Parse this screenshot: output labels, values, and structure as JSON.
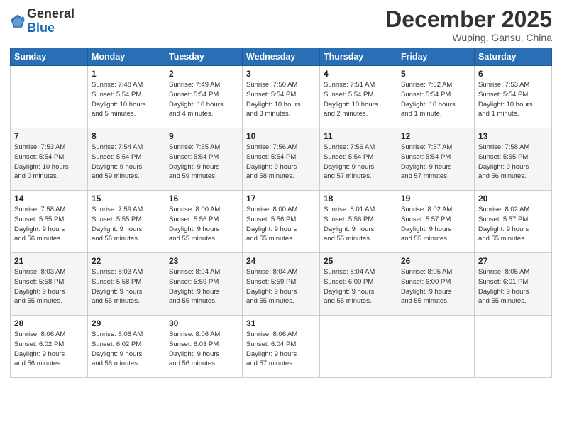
{
  "logo": {
    "general": "General",
    "blue": "Blue"
  },
  "header": {
    "month": "December 2025",
    "location": "Wuping, Gansu, China"
  },
  "days_of_week": [
    "Sunday",
    "Monday",
    "Tuesday",
    "Wednesday",
    "Thursday",
    "Friday",
    "Saturday"
  ],
  "weeks": [
    [
      {
        "day": "",
        "info": ""
      },
      {
        "day": "1",
        "info": "Sunrise: 7:48 AM\nSunset: 5:54 PM\nDaylight: 10 hours\nand 5 minutes."
      },
      {
        "day": "2",
        "info": "Sunrise: 7:49 AM\nSunset: 5:54 PM\nDaylight: 10 hours\nand 4 minutes."
      },
      {
        "day": "3",
        "info": "Sunrise: 7:50 AM\nSunset: 5:54 PM\nDaylight: 10 hours\nand 3 minutes."
      },
      {
        "day": "4",
        "info": "Sunrise: 7:51 AM\nSunset: 5:54 PM\nDaylight: 10 hours\nand 2 minutes."
      },
      {
        "day": "5",
        "info": "Sunrise: 7:52 AM\nSunset: 5:54 PM\nDaylight: 10 hours\nand 1 minute."
      },
      {
        "day": "6",
        "info": "Sunrise: 7:53 AM\nSunset: 5:54 PM\nDaylight: 10 hours\nand 1 minute."
      }
    ],
    [
      {
        "day": "7",
        "info": "Sunrise: 7:53 AM\nSunset: 5:54 PM\nDaylight: 10 hours\nand 0 minutes."
      },
      {
        "day": "8",
        "info": "Sunrise: 7:54 AM\nSunset: 5:54 PM\nDaylight: 9 hours\nand 59 minutes."
      },
      {
        "day": "9",
        "info": "Sunrise: 7:55 AM\nSunset: 5:54 PM\nDaylight: 9 hours\nand 59 minutes."
      },
      {
        "day": "10",
        "info": "Sunrise: 7:56 AM\nSunset: 5:54 PM\nDaylight: 9 hours\nand 58 minutes."
      },
      {
        "day": "11",
        "info": "Sunrise: 7:56 AM\nSunset: 5:54 PM\nDaylight: 9 hours\nand 57 minutes."
      },
      {
        "day": "12",
        "info": "Sunrise: 7:57 AM\nSunset: 5:54 PM\nDaylight: 9 hours\nand 57 minutes."
      },
      {
        "day": "13",
        "info": "Sunrise: 7:58 AM\nSunset: 5:55 PM\nDaylight: 9 hours\nand 56 minutes."
      }
    ],
    [
      {
        "day": "14",
        "info": "Sunrise: 7:58 AM\nSunset: 5:55 PM\nDaylight: 9 hours\nand 56 minutes."
      },
      {
        "day": "15",
        "info": "Sunrise: 7:59 AM\nSunset: 5:55 PM\nDaylight: 9 hours\nand 56 minutes."
      },
      {
        "day": "16",
        "info": "Sunrise: 8:00 AM\nSunset: 5:56 PM\nDaylight: 9 hours\nand 55 minutes."
      },
      {
        "day": "17",
        "info": "Sunrise: 8:00 AM\nSunset: 5:56 PM\nDaylight: 9 hours\nand 55 minutes."
      },
      {
        "day": "18",
        "info": "Sunrise: 8:01 AM\nSunset: 5:56 PM\nDaylight: 9 hours\nand 55 minutes."
      },
      {
        "day": "19",
        "info": "Sunrise: 8:02 AM\nSunset: 5:57 PM\nDaylight: 9 hours\nand 55 minutes."
      },
      {
        "day": "20",
        "info": "Sunrise: 8:02 AM\nSunset: 5:57 PM\nDaylight: 9 hours\nand 55 minutes."
      }
    ],
    [
      {
        "day": "21",
        "info": "Sunrise: 8:03 AM\nSunset: 5:58 PM\nDaylight: 9 hours\nand 55 minutes."
      },
      {
        "day": "22",
        "info": "Sunrise: 8:03 AM\nSunset: 5:58 PM\nDaylight: 9 hours\nand 55 minutes."
      },
      {
        "day": "23",
        "info": "Sunrise: 8:04 AM\nSunset: 5:59 PM\nDaylight: 9 hours\nand 55 minutes."
      },
      {
        "day": "24",
        "info": "Sunrise: 8:04 AM\nSunset: 5:59 PM\nDaylight: 9 hours\nand 55 minutes."
      },
      {
        "day": "25",
        "info": "Sunrise: 8:04 AM\nSunset: 6:00 PM\nDaylight: 9 hours\nand 55 minutes."
      },
      {
        "day": "26",
        "info": "Sunrise: 8:05 AM\nSunset: 6:00 PM\nDaylight: 9 hours\nand 55 minutes."
      },
      {
        "day": "27",
        "info": "Sunrise: 8:05 AM\nSunset: 6:01 PM\nDaylight: 9 hours\nand 55 minutes."
      }
    ],
    [
      {
        "day": "28",
        "info": "Sunrise: 8:06 AM\nSunset: 6:02 PM\nDaylight: 9 hours\nand 56 minutes."
      },
      {
        "day": "29",
        "info": "Sunrise: 8:06 AM\nSunset: 6:02 PM\nDaylight: 9 hours\nand 56 minutes."
      },
      {
        "day": "30",
        "info": "Sunrise: 8:06 AM\nSunset: 6:03 PM\nDaylight: 9 hours\nand 56 minutes."
      },
      {
        "day": "31",
        "info": "Sunrise: 8:06 AM\nSunset: 6:04 PM\nDaylight: 9 hours\nand 57 minutes."
      },
      {
        "day": "",
        "info": ""
      },
      {
        "day": "",
        "info": ""
      },
      {
        "day": "",
        "info": ""
      }
    ]
  ]
}
